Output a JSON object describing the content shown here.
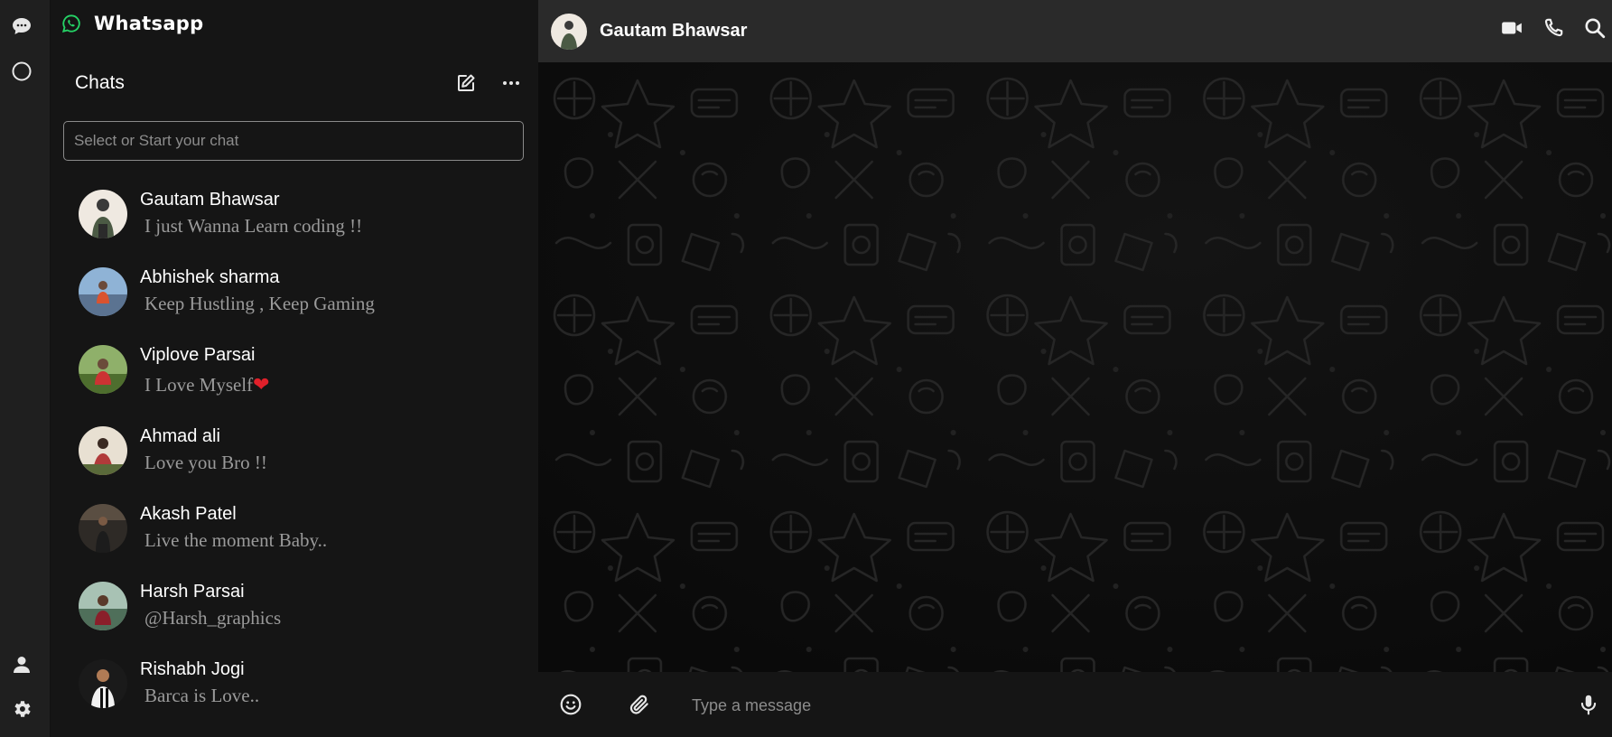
{
  "app": {
    "brand_title": "Whatsapp",
    "brand_color": "#25d366"
  },
  "rail": {
    "items": [
      {
        "icon": "chat-bubble-icon"
      },
      {
        "icon": "status-circle-icon"
      },
      {
        "icon": "user-profile-icon"
      },
      {
        "icon": "gear-icon"
      }
    ]
  },
  "chat_panel": {
    "title": "Chats",
    "search_placeholder": "Select or Start your chat",
    "chats": [
      {
        "name": "Gautam Bhawsar",
        "message": "I just Wanna Learn coding !!",
        "avatar_color": "#d9d2c8"
      },
      {
        "name": "Abhishek sharma",
        "message": "Keep Hustling , Keep Gaming",
        "avatar_color": "#8aa9c6"
      },
      {
        "name": "Viplove Parsai",
        "message": "I Love Myself",
        "emoji": "❤",
        "avatar_color": "#6c7d4a"
      },
      {
        "name": "Ahmad ali",
        "message": "Love you Bro !!",
        "avatar_color": "#a34040"
      },
      {
        "name": "Akash Patel",
        "message": "Live the moment Baby..",
        "avatar_color": "#3b3b3b"
      },
      {
        "name": "Harsh Parsai",
        "message": "@Harsh_graphics",
        "avatar_color": "#5b7f6a"
      },
      {
        "name": "Rishabh Jogi",
        "message": "Barca is Love..",
        "avatar_color": "#222222"
      }
    ]
  },
  "conversation": {
    "contact_name": "Gautam Bhawsar",
    "message_placeholder": "Type a message"
  }
}
